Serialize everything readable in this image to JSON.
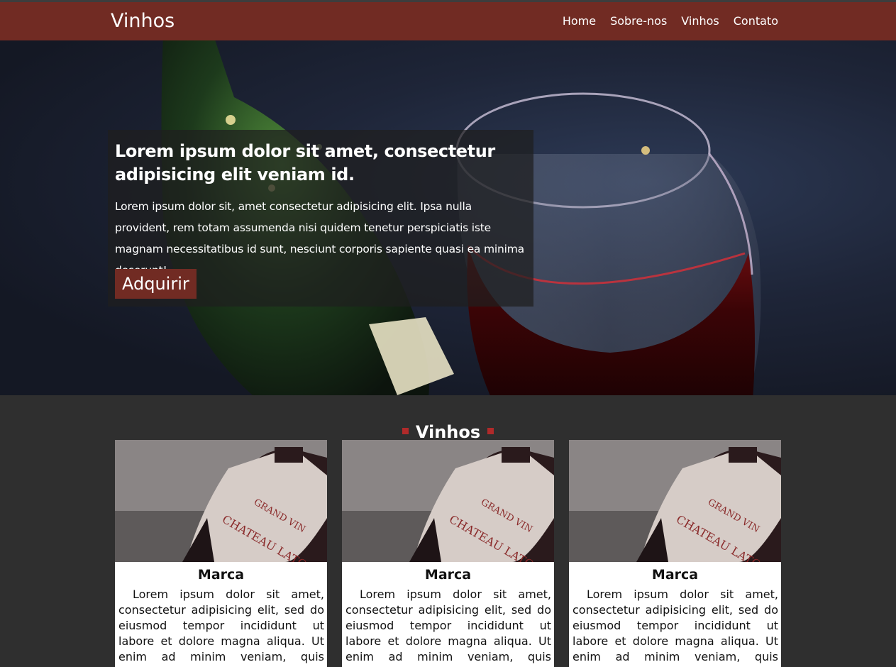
{
  "navbar": {
    "brand": "Vinhos",
    "links": [
      "Home",
      "Sobre-nos",
      "Vinhos",
      "Contato"
    ]
  },
  "hero": {
    "title": "Lorem ipsum dolor sit amet, consectetur adipisicing elit veniam id.",
    "text": "Lorem ipsum dolor sit, amet consectetur adipisicing elit. Ipsa nulla provident, rem totam assumenda nisi quidem tenetur perspiciatis iste magnam necessitatibus id sunt, nesciunt corporis sapiente quasi ea minima deserunt!",
    "button": "Adquirir"
  },
  "section": {
    "title": "Vinhos"
  },
  "cards": [
    {
      "title": "Marca",
      "text": "Lorem ipsum dolor sit amet, consectetur adipisicing elit, sed do eiusmod tempor incididunt ut labore et dolore magna aliqua. Ut enim ad minim veniam, quis nostrud",
      "label_top": "GRAND VIN",
      "label_name": "CHATEAU LATOUR"
    },
    {
      "title": "Marca",
      "text": "Lorem ipsum dolor sit amet, consectetur adipisicing elit, sed do eiusmod tempor incididunt ut labore et dolore magna aliqua. Ut enim ad minim veniam, quis nostrud",
      "label_top": "GRAND VIN",
      "label_name": "CHATEAU LATOUR"
    },
    {
      "title": "Marca",
      "text": "Lorem ipsum dolor sit amet, consectetur adipisicing elit, sed do eiusmod tempor incididunt ut labore et dolore magna aliqua. Ut enim ad minim veniam, quis nostrud",
      "label_top": "GRAND VIN",
      "label_name": "CHATEAU LATOUR"
    }
  ],
  "colors": {
    "navbar": "#712b23",
    "page_background": "#2f2f2f",
    "accent": "#b02a2a"
  }
}
